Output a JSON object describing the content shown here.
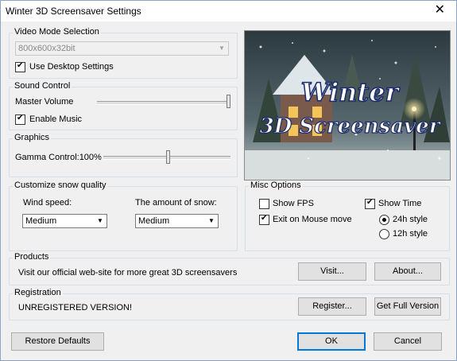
{
  "window": {
    "title": "Winter 3D Screensaver Settings"
  },
  "video": {
    "legend": "Video Mode Selection",
    "mode_value": "800x600x32bit",
    "use_desktop_label": "Use Desktop Settings",
    "use_desktop_checked": true
  },
  "sound": {
    "legend": "Sound Control",
    "master_volume_label": "Master Volume",
    "master_volume_level": 1.0,
    "enable_music_label": "Enable Music",
    "enable_music_checked": true
  },
  "graphics": {
    "legend": "Graphics",
    "gamma_label": "Gamma Control:100%",
    "gamma_level": 0.5
  },
  "banner": {
    "line1": "Winter",
    "line2": "3D Screensaver"
  },
  "snow": {
    "legend": "Customize snow quality",
    "wind_label": "Wind speed:",
    "wind_value": "Medium",
    "amount_label": "The amount of snow:",
    "amount_value": "Medium"
  },
  "misc": {
    "legend": "Misc Options",
    "show_fps_label": "Show FPS",
    "show_fps_checked": false,
    "show_time_label": "Show Time",
    "show_time_checked": true,
    "exit_mouse_label": "Exit on Mouse move",
    "exit_mouse_checked": true,
    "style_24_label": "24h style",
    "style_12_label": "12h style",
    "selected_style": "24h"
  },
  "products": {
    "legend": "Products",
    "text": "Visit our official web-site for more great 3D screensavers",
    "visit_label": "Visit...",
    "about_label": "About..."
  },
  "registration": {
    "legend": "Registration",
    "status": "UNREGISTERED VERSION!",
    "register_label": "Register...",
    "full_version_label": "Get Full Version"
  },
  "footer": {
    "restore_label": "Restore Defaults",
    "ok_label": "OK",
    "cancel_label": "Cancel"
  },
  "colors": {
    "accent": "#0078d7",
    "banner_text": "#1a2a6a"
  },
  "icons": {
    "close": "close-icon",
    "dropdown": "chevron-down-icon"
  }
}
